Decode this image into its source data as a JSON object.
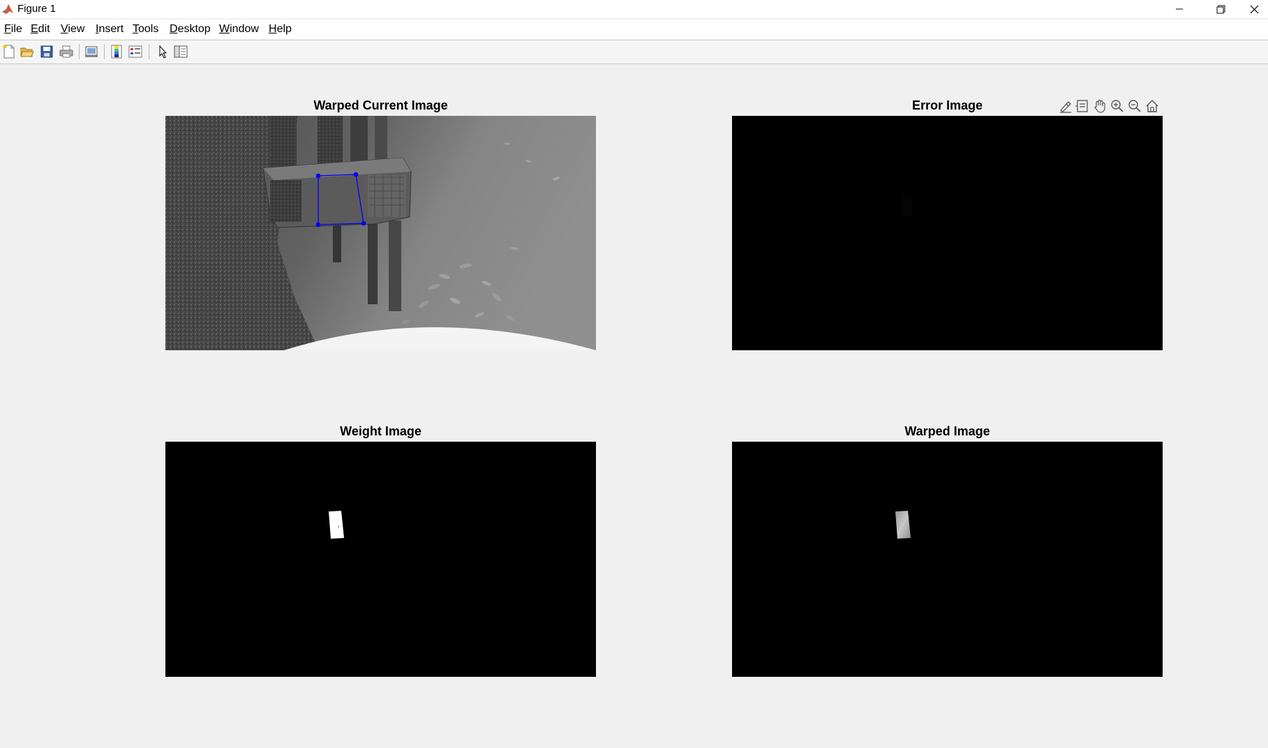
{
  "window": {
    "title": "Figure 1",
    "controls": [
      "minimize",
      "restore",
      "close"
    ]
  },
  "menu": {
    "items": [
      {
        "label": "File",
        "accel": "F"
      },
      {
        "label": "Edit",
        "accel": "E"
      },
      {
        "label": "View",
        "accel": "V"
      },
      {
        "label": "Insert",
        "accel": "I"
      },
      {
        "label": "Tools",
        "accel": "T"
      },
      {
        "label": "Desktop",
        "accel": "D"
      },
      {
        "label": "Window",
        "accel": "W"
      },
      {
        "label": "Help",
        "accel": "H"
      }
    ]
  },
  "toolbar": {
    "icons": [
      "new-figure-icon",
      "open-file-icon",
      "save-icon",
      "print-icon",
      "link-plot-icon",
      "insert-colorbar-icon",
      "insert-legend-icon",
      "edit-plot-icon",
      "property-inspector-icon"
    ]
  },
  "axes_toolbar": {
    "icons": [
      "brush-icon",
      "data-tips-icon",
      "pan-icon",
      "zoom-in-icon",
      "zoom-out-icon",
      "restore-view-icon"
    ]
  },
  "plots": {
    "top_left": {
      "title": "Warped Current Image"
    },
    "top_right": {
      "title": "Error Image"
    },
    "bottom_left": {
      "title": "Weight Image"
    },
    "bottom_right": {
      "title": "Warped Image"
    }
  },
  "colors": {
    "window_bg": "#f0f0f0",
    "axes_bg": "#000000",
    "overlay_quad": "#0000ff",
    "matlab_icon": "#d9542a"
  }
}
